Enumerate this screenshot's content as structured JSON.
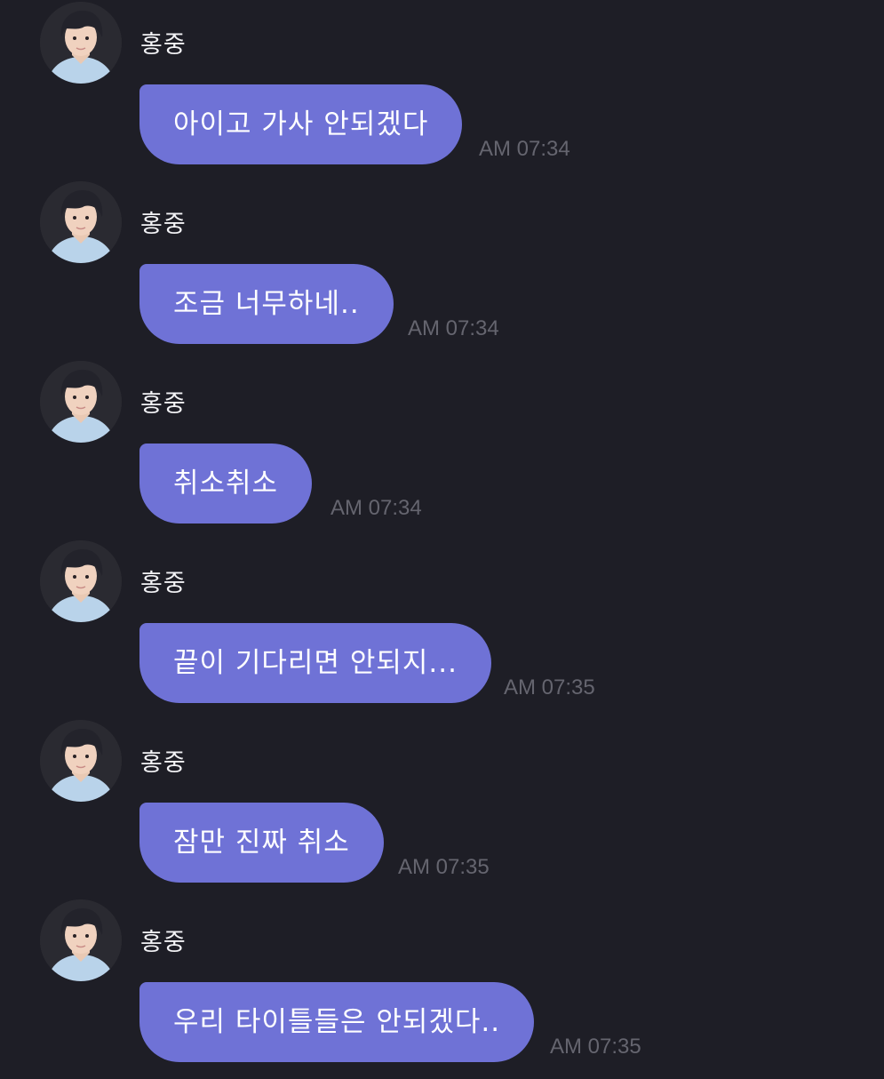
{
  "chat": {
    "messages": [
      {
        "sender": "홍중",
        "avatar": "profile-photo",
        "text": "아이고 가사 안되겠다",
        "time": "AM 07:34"
      },
      {
        "sender": "홍중",
        "avatar": "profile-photo",
        "text": "조금 너무하네..",
        "time": "AM 07:34"
      },
      {
        "sender": "홍중",
        "avatar": "profile-photo",
        "text": "취소취소",
        "time": "AM 07:34"
      },
      {
        "sender": "홍중",
        "avatar": "profile-photo",
        "text": "끝이 기다리면 안되지...",
        "time": "AM 07:35"
      },
      {
        "sender": "홍중",
        "avatar": "profile-photo",
        "text": "잠만 진짜 취소",
        "time": "AM 07:35"
      },
      {
        "sender": "홍중",
        "avatar": "profile-photo",
        "text": "우리 타이틀들은 안되겠다..",
        "time": "AM 07:35"
      }
    ]
  },
  "colors": {
    "background": "#1e1e26",
    "bubble": "#6f72d6",
    "bubble_text": "#ffffff",
    "name_text": "#f2f2f5",
    "timestamp_text": "#65656f"
  }
}
